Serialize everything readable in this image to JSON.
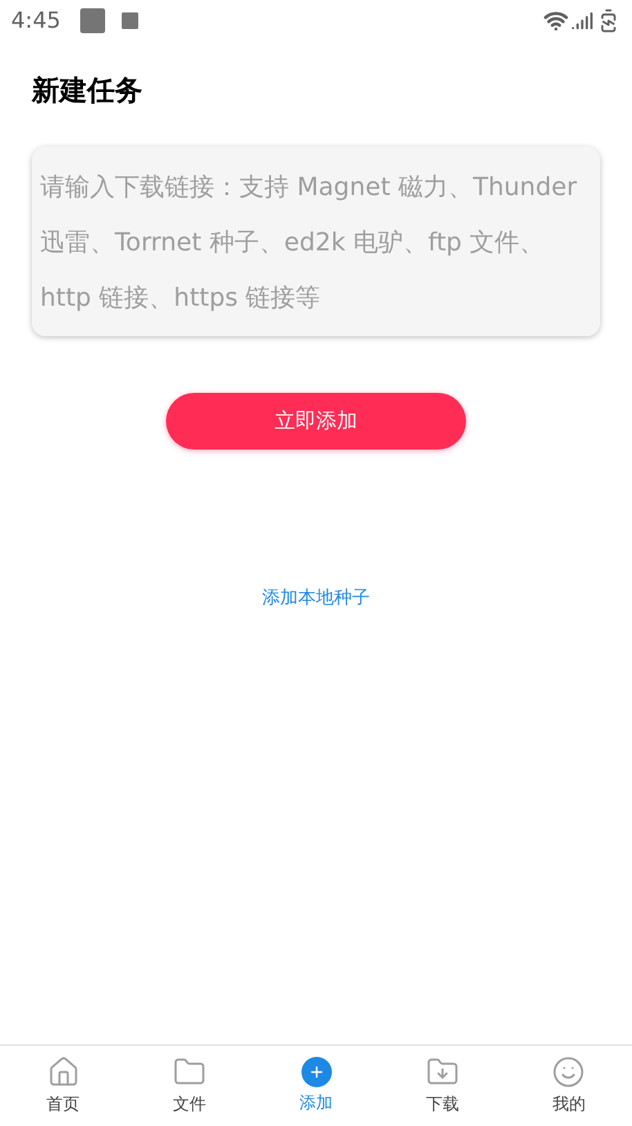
{
  "status_bar": {
    "time": "4:45"
  },
  "title": "新建任务",
  "link_field": {
    "placeholder": "请输入下载链接：支持 Magnet 磁力、Thunder 迅雷、Torrnet 种子、ed2k 电驴、ftp 文件、http 链接、https 链接等"
  },
  "add_button": "立即添加",
  "local_seed_link": "添加本地种子",
  "tabs": [
    {
      "kind": "home",
      "label": "首页",
      "selected": false
    },
    {
      "kind": "files",
      "label": "文件",
      "selected": false
    },
    {
      "kind": "add",
      "label": "添加",
      "selected": true
    },
    {
      "kind": "download",
      "label": "下载",
      "selected": false
    },
    {
      "kind": "me",
      "label": "我的",
      "selected": false
    }
  ]
}
